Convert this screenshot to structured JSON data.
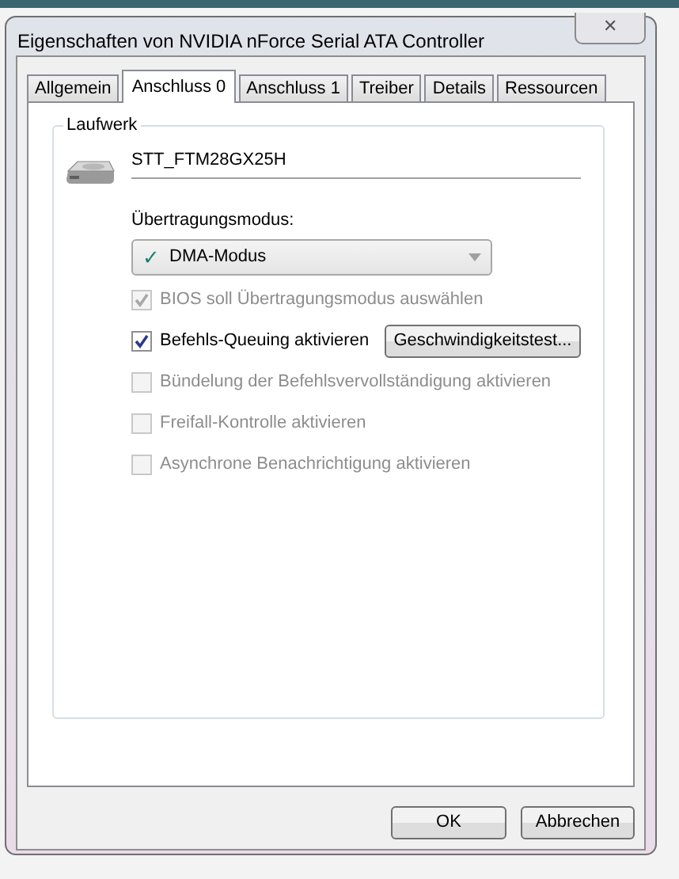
{
  "window": {
    "title": "Eigenschaften von NVIDIA nForce Serial ATA Controller",
    "close": "✕"
  },
  "tabs": [
    {
      "label": "Allgemein",
      "selected": false
    },
    {
      "label": "Anschluss 0",
      "selected": true
    },
    {
      "label": "Anschluss 1",
      "selected": false
    },
    {
      "label": "Treiber",
      "selected": false
    },
    {
      "label": "Details",
      "selected": false
    },
    {
      "label": "Ressourcen",
      "selected": false
    }
  ],
  "group": {
    "title": "Laufwerk",
    "drive_name": "STT_FTM28GX25H",
    "mode_label": "Übertragungsmodus:",
    "mode_value": "DMA-Modus",
    "mode_check": "✓"
  },
  "options": [
    {
      "label": "BIOS soll Übertragungsmodus auswählen",
      "checked": true,
      "disabled": true
    },
    {
      "label": "Befehls-Queuing aktivieren",
      "checked": true,
      "disabled": false,
      "button": "Geschwindigkeitstest..."
    },
    {
      "label": "Bündelung der Befehlsvervollständigung aktivieren",
      "checked": false,
      "disabled": true
    },
    {
      "label": "Freifall-Kontrolle aktivieren",
      "checked": false,
      "disabled": true
    },
    {
      "label": "Asynchrone Benachrichtigung aktivieren",
      "checked": false,
      "disabled": true
    }
  ],
  "buttons": [
    "OK",
    "Abbrechen"
  ]
}
